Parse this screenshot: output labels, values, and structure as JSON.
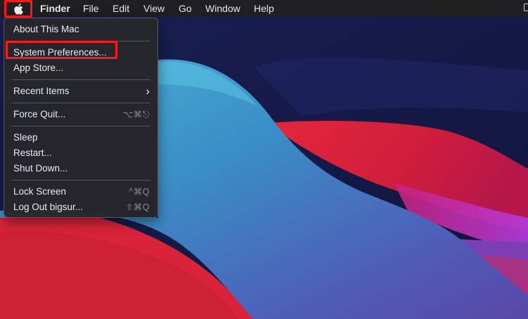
{
  "menubar": {
    "apple_menu_icon": "apple-logo-icon",
    "items": [
      "Finder",
      "File",
      "Edit",
      "View",
      "Go",
      "Window",
      "Help"
    ]
  },
  "apple_menu": {
    "about": "About This Mac",
    "system_preferences": "System Preferences...",
    "app_store": "App Store...",
    "recent_items": "Recent Items",
    "recent_items_icon": "chevron-right-icon",
    "force_quit": "Force Quit...",
    "force_quit_shortcut": "⌥⌘⎋",
    "sleep": "Sleep",
    "restart": "Restart...",
    "shut_down": "Shut Down...",
    "lock_screen": "Lock Screen",
    "lock_screen_shortcut": "^⌘Q",
    "log_out": "Log Out bigsur...",
    "log_out_shortcut": "⇧⌘Q"
  },
  "highlight_color": "#ff1a1a"
}
